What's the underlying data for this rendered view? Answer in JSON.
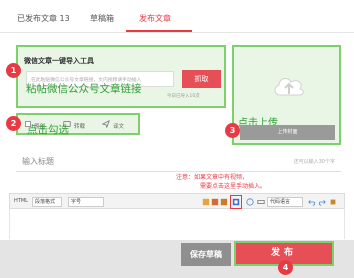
{
  "tabs": [
    {
      "label": "已发布文章 13"
    },
    {
      "label": "草稿箱"
    },
    {
      "label": "发布文章"
    }
  ],
  "import": {
    "title": "微信文章一键导入工具",
    "placeholder": "在此粘贴微信公众号文章链接，文内视频请手动插入",
    "overlay": "粘帖微信公众号文章链接",
    "fetch_label": "抓取",
    "today_count": "今日已导入10次"
  },
  "options": {
    "overlay": "点击勾选",
    "items": [
      {
        "label": "原创"
      },
      {
        "label": "转载"
      },
      {
        "label": "译文"
      }
    ]
  },
  "upload": {
    "overlay": "点击上传",
    "button_label": "上传封面"
  },
  "title_input": {
    "placeholder": "输入标题",
    "counter": "还可以输入30个字"
  },
  "note": {
    "line1": "注意：如果文章中有视频，",
    "line2": "需要点击这里手动插入。"
  },
  "toolbar": {
    "html_label": "HTML",
    "paragraph_select": "段落格式",
    "font_select": "字号",
    "code_select": "代码语言"
  },
  "actions": {
    "save_label": "保存草稿",
    "publish_label": "发布"
  },
  "markers": [
    "1",
    "2",
    "3",
    "4"
  ],
  "colors": {
    "accent": "#e83a45",
    "highlight_green": "#7dd06b",
    "overlay_text": "#2f9f34"
  }
}
